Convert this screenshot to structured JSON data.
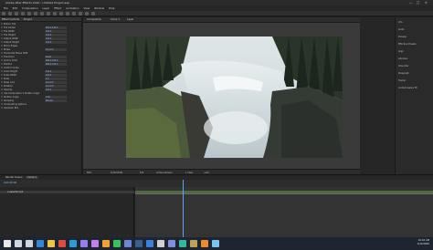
{
  "app": {
    "title": "Adobe After Effects 2020 - Untitled Project.aep"
  },
  "menu": [
    "File",
    "Edit",
    "Composition",
    "Layer",
    "Effect",
    "Animation",
    "View",
    "Window",
    "Help"
  ],
  "left_panel": {
    "tabs": [
      "Effect Controls",
      "Project"
    ],
    "rows": [
      {
        "label": "Motion Tile",
        "value": ""
      },
      {
        "label": "Tile Center",
        "value": "960.0,540.0"
      },
      {
        "label": "Tile Width",
        "value": "100.0"
      },
      {
        "label": "Tile Height",
        "value": "100.0"
      },
      {
        "label": "Output Width",
        "value": "100.0"
      },
      {
        "label": "Output Height",
        "value": "100.0"
      },
      {
        "label": "Mirror Edges",
        "value": ""
      },
      {
        "label": "Phase",
        "value": "0x+0.0°"
      },
      {
        "label": "Horizontal Phase Shift",
        "value": ""
      },
      {
        "label": "Transform",
        "value": "Reset"
      },
      {
        "label": "Anchor Point",
        "value": "960.0,540.0"
      },
      {
        "label": "Position",
        "value": "960.0,540.0"
      },
      {
        "label": "Uniform Scale",
        "value": ""
      },
      {
        "label": "Scale Height",
        "value": "100.0"
      },
      {
        "label": "Scale Width",
        "value": "100.0"
      },
      {
        "label": "Skew",
        "value": "0.0"
      },
      {
        "label": "Skew Axis",
        "value": "0x+0.0°"
      },
      {
        "label": "Rotation",
        "value": "0x+0.0°"
      },
      {
        "label": "Opacity",
        "value": "100.0"
      },
      {
        "label": "Use Composition's Shutter Angle",
        "value": ""
      },
      {
        "label": "Shutter Angle",
        "value": "0.00"
      },
      {
        "label": "Sampling",
        "value": "Bilinear"
      },
      {
        "label": "Compositing Options",
        "value": ""
      },
      {
        "label": "Gaussian Blur",
        "value": ""
      }
    ]
  },
  "comp_tabs": [
    "Composition",
    "Comp 1",
    "Layer"
  ],
  "viewer_bar": [
    "50%",
    "0:00:00:00",
    "Full",
    "Active Camera",
    "1 View",
    "+0.0"
  ],
  "right_panel": [
    "Info",
    "Audio",
    "Preview",
    "Effects & Presets",
    "Align",
    "Libraries",
    "Character",
    "Paragraph",
    "Tracker",
    "Content-Aware Fill"
  ],
  "timeline": {
    "tabs": [
      "Render Queue",
      "Comp 1"
    ],
    "timecode": "0:00:00:00",
    "layers": [
      "1  waterfall.mp4"
    ]
  },
  "taskbar": {
    "time": "10:42 AM",
    "date": "3/12/2020",
    "icons": [
      {
        "name": "start",
        "color": "#e8e8e8"
      },
      {
        "name": "search",
        "color": "#cfd6df"
      },
      {
        "name": "task-view",
        "color": "#cfd6df"
      },
      {
        "name": "edge",
        "color": "#2f86d6"
      },
      {
        "name": "file-explorer",
        "color": "#f0c445"
      },
      {
        "name": "chrome",
        "color": "#e04b3a"
      },
      {
        "name": "photoshop",
        "color": "#2d9bd6"
      },
      {
        "name": "after-effects",
        "color": "#9b7cf0"
      },
      {
        "name": "premiere",
        "color": "#c57ef0"
      },
      {
        "name": "illustrator",
        "color": "#f3a32c"
      },
      {
        "name": "spotify",
        "color": "#38c15e"
      },
      {
        "name": "discord",
        "color": "#6f86d8"
      },
      {
        "name": "steam",
        "color": "#3a5f8c"
      },
      {
        "name": "mail",
        "color": "#3b80d8"
      },
      {
        "name": "settings",
        "color": "#d0d0d0"
      },
      {
        "name": "media-encoder",
        "color": "#7c8fe0"
      },
      {
        "name": "audition",
        "color": "#2fb7a0"
      },
      {
        "name": "bridge",
        "color": "#c0a15b"
      },
      {
        "name": "vlc",
        "color": "#f08a2a"
      },
      {
        "name": "notepad",
        "color": "#7cc4f0"
      }
    ]
  }
}
